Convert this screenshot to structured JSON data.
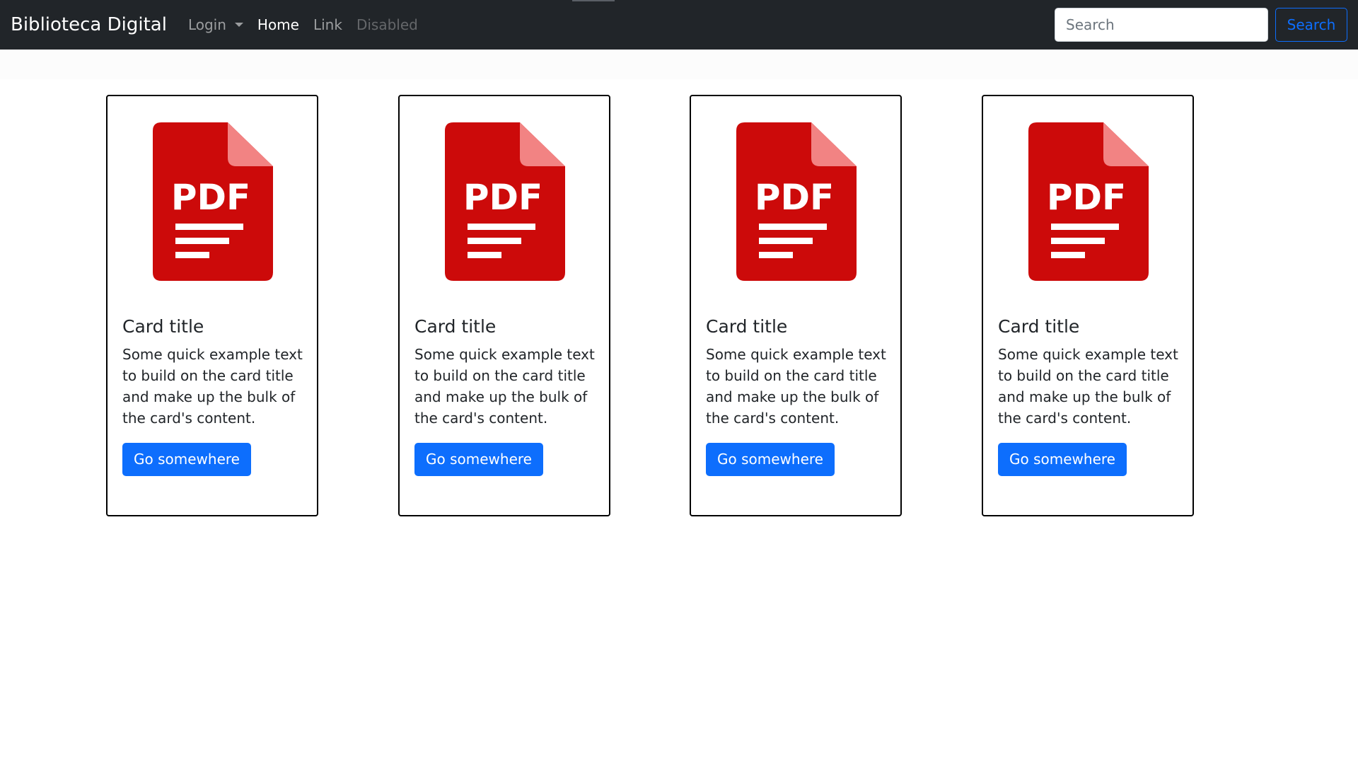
{
  "navbar": {
    "brand": "Biblioteca Digital",
    "items": [
      {
        "label": "Login"
      },
      {
        "label": "Home"
      },
      {
        "label": "Link"
      },
      {
        "label": "Disabled"
      }
    ],
    "search": {
      "placeholder": "Search",
      "button_label": "Search"
    }
  },
  "colors": {
    "navbar_bg": "#212529",
    "primary": "#0d6efd",
    "pdf_red": "#cc0a0a",
    "pdf_fold": "#f28383"
  },
  "cards": [
    {
      "icon": "pdf-file-icon",
      "icon_text": "PDF",
      "title": "Card title",
      "text": "Some quick example text to build on the card title and make up the bulk of the card's content.",
      "button_label": "Go somewhere"
    },
    {
      "icon": "pdf-file-icon",
      "icon_text": "PDF",
      "title": "Card title",
      "text": "Some quick example text to build on the card title and make up the bulk of the card's content.",
      "button_label": "Go somewhere"
    },
    {
      "icon": "pdf-file-icon",
      "icon_text": "PDF",
      "title": "Card title",
      "text": "Some quick example text to build on the card title and make up the bulk of the card's content.",
      "button_label": "Go somewhere"
    },
    {
      "icon": "pdf-file-icon",
      "icon_text": "PDF",
      "title": "Card title",
      "text": "Some quick example text to build on the card title and make up the bulk of the card's content.",
      "button_label": "Go somewhere"
    }
  ]
}
